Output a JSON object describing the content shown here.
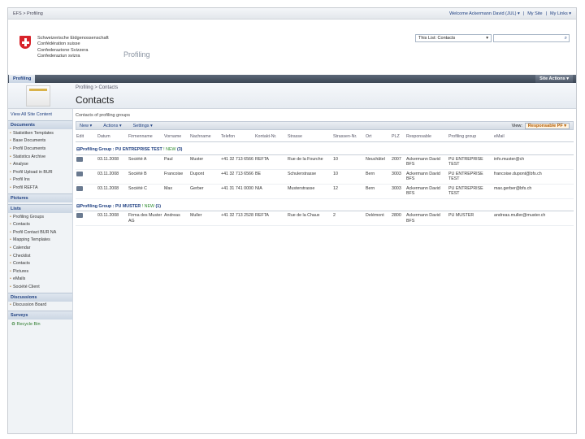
{
  "topbar": {
    "breadcrumb": "EFS > Profiling",
    "welcome": "Welcome Ackermann David (JUL) ▾",
    "mysite": "My Site",
    "mylinks": "My Links ▾"
  },
  "header": {
    "confederation": [
      "Schweizerische Eidgenossenschaft",
      "Confédération suisse",
      "Confederazione Svizzera",
      "Confederaziun svizra"
    ],
    "site_title": "Profiling",
    "search_scope": "This List: Contacts"
  },
  "nav": {
    "tab": "Profiling",
    "site_actions": "Site Actions ▾"
  },
  "title": {
    "breadcrumb": "Profiling > Contacts",
    "page_title": "Contacts"
  },
  "leftnav": {
    "view_all": "View All Site Content",
    "documents_head": "Documents",
    "documents": [
      "Statistiken Templates",
      "Base Documents",
      "Profil Documents",
      "Statistics Archive",
      "Analyse",
      "Profil Upload in BUR",
      "Profil Ins",
      "Profil REFTA"
    ],
    "pictures_head": "Pictures",
    "lists_head": "Lists",
    "lists": [
      "Profiling Groups",
      "Contacts",
      "Profil Contact BUR NA",
      "Mapping Templates",
      "Calendar",
      "Checklist",
      "Contacts",
      "Pictures",
      "eMails",
      "Société Client"
    ],
    "discussions_head": "Discussions",
    "discussions": [
      "Discussion Board"
    ],
    "surveys_head": "Surveys",
    "recycle": "Recycle Bin"
  },
  "content": {
    "description": "Contacts of profiling groups",
    "toolbar": {
      "new": "New ▾",
      "actions": "Actions ▾",
      "settings": "Settings ▾",
      "view_label": "View:",
      "view_value": "Responsable PF ▾"
    },
    "columns": [
      "Edit",
      "Datum",
      "Firmenname",
      "Vorname",
      "Nachname",
      "Telefon",
      "Kontakt-Nr.",
      "Strasse",
      "Strassen-Nr.",
      "Ort",
      "PLZ",
      "Responsable",
      "Profiling group",
      "eMail"
    ],
    "groups": [
      {
        "label": "Profiling Group : PU ENTREPRISE TEST",
        "new": "! NEW",
        "count": "(3)",
        "rows": [
          [
            "03.11.2008",
            "Société A",
            "Paul",
            "Muster",
            "+41 32 713 6566",
            "REFTA",
            "Rue de la Fourche",
            "10",
            "Neuchâtel",
            "2007",
            "Ackermann David BFS",
            "PU ENTREPRISE TEST",
            "info.muster@ch"
          ],
          [
            "03.11.2008",
            "Société B",
            "Francoise",
            "Dupont",
            "+41 32 713 6566",
            "BE",
            "Schulerstrasse",
            "10",
            "Bern",
            "3003",
            "Ackermann David BFS",
            "PU ENTREPRISE TEST",
            "francoise.dupont@bfs.ch"
          ],
          [
            "03.11.2008",
            "Société C",
            "Max",
            "Gerber",
            "+41 31 741 0000",
            "NIA",
            "Musterstrasse",
            "12",
            "Bern",
            "3003",
            "Ackermann David BFS",
            "PU ENTREPRISE TEST",
            "max.gerber@bfs.ch"
          ]
        ]
      },
      {
        "label": "Profiling Group : PU MUSTER",
        "new": "! NEW",
        "count": "(1)",
        "rows": [
          [
            "03.11.2008",
            "Firma des Muster AG",
            "Andreas",
            "Muller",
            "+41 32 713 2528",
            "REFTA",
            "Rue de la Chaux",
            "2",
            "Delémont",
            "2800",
            "Ackermann David BFS",
            "PU MUSTER",
            "andreas.muller@muster.ch"
          ]
        ]
      }
    ]
  }
}
